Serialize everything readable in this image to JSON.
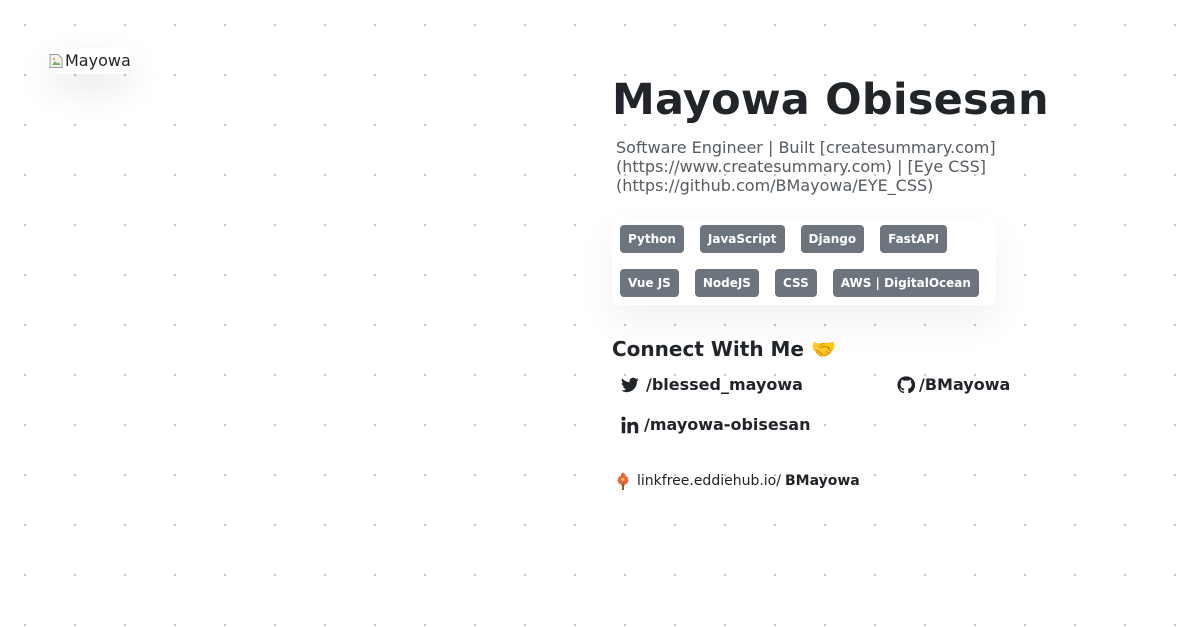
{
  "avatar": {
    "alt": "Mayowa"
  },
  "profile": {
    "name": "Mayowa Obisesan",
    "bio": "Software Engineer | Built [createsummary.com](https://www.createsummary.com) | [Eye CSS](https://github.com/BMayowa/EYE_CSS)"
  },
  "skills": [
    "Python",
    "JavaScript",
    "Django",
    "FastAPI",
    "Vue JS",
    "NodeJS",
    "CSS",
    "AWS | DigitalOcean"
  ],
  "connect": {
    "title": "Connect With Me 🤝",
    "twitter": "/blessed_mayowa",
    "github": "/BMayowa",
    "linkedin": "/mayowa-obisesan"
  },
  "linkfree": {
    "domain": "linkfree.eddiehub.io/",
    "username": "BMayowa"
  },
  "icons": {
    "avatar": "broken-image-icon",
    "twitter": "twitter-icon",
    "github": "github-icon",
    "linkedin": "linkedin-icon",
    "linkfree": "linkfree-logo-icon"
  },
  "colors": {
    "text": "#212529",
    "bio": "#555b61",
    "badge": "#6c757d",
    "badge_text": "#ffffff",
    "dots": "#c4c4c4"
  }
}
